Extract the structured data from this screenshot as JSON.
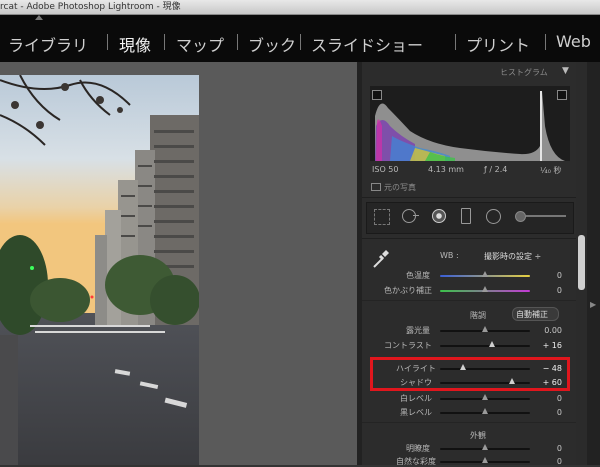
{
  "window": {
    "title": "rcat - Adobe Photoshop Lightroom - 現像"
  },
  "modules": [
    {
      "label": "ライブラリ",
      "active": false
    },
    {
      "label": "現像",
      "active": true
    },
    {
      "label": "マップ",
      "active": false
    },
    {
      "label": "ブック",
      "active": false
    },
    {
      "label": "スライドショー",
      "active": false
    },
    {
      "label": "プリント",
      "active": false
    },
    {
      "label": "Web",
      "active": false
    }
  ],
  "histogram": {
    "title": "ヒストグラム",
    "iso": "ISO 50",
    "focal": "4.13 mm",
    "aperture": "ƒ / 2.4",
    "shutter": "¹⁄₄₀ 秒",
    "original_label": "元の写真"
  },
  "basic": {
    "wb_label": "WB :",
    "wb_value": "撮影時の設定 ÷",
    "temp_label": "色温度",
    "temp_value": "0",
    "tint_label": "色かぶり補正",
    "tint_value": "0",
    "tone_title": "階調",
    "auto_label": "自動補正",
    "exposure_label": "露光量",
    "exposure_value": "0.00",
    "contrast_label": "コントラスト",
    "contrast_value": "+ 16",
    "highlights_label": "ハイライト",
    "highlights_value": "− 48",
    "shadows_label": "シャドウ",
    "shadows_value": "+ 60",
    "whites_label": "白レベル",
    "whites_value": "0",
    "blacks_label": "黒レベル",
    "blacks_value": "0",
    "presence_title": "外観",
    "clarity_label": "明瞭度",
    "clarity_value": "0",
    "vibrance_label": "自然な彩度",
    "vibrance_value": "0"
  },
  "sliders": {
    "temp": 0.5,
    "tint": 0.5,
    "exposure": 0.5,
    "contrast": 0.58,
    "highlights": 0.26,
    "shadows": 0.8,
    "whites": 0.5,
    "blacks": 0.5,
    "clarity": 0.5,
    "vibrance": 0.5
  },
  "colors": {
    "highlight_box": "#e0161d",
    "panel_bg": "#2c2c2c",
    "module_bar_bg": "#0a0a0a"
  }
}
